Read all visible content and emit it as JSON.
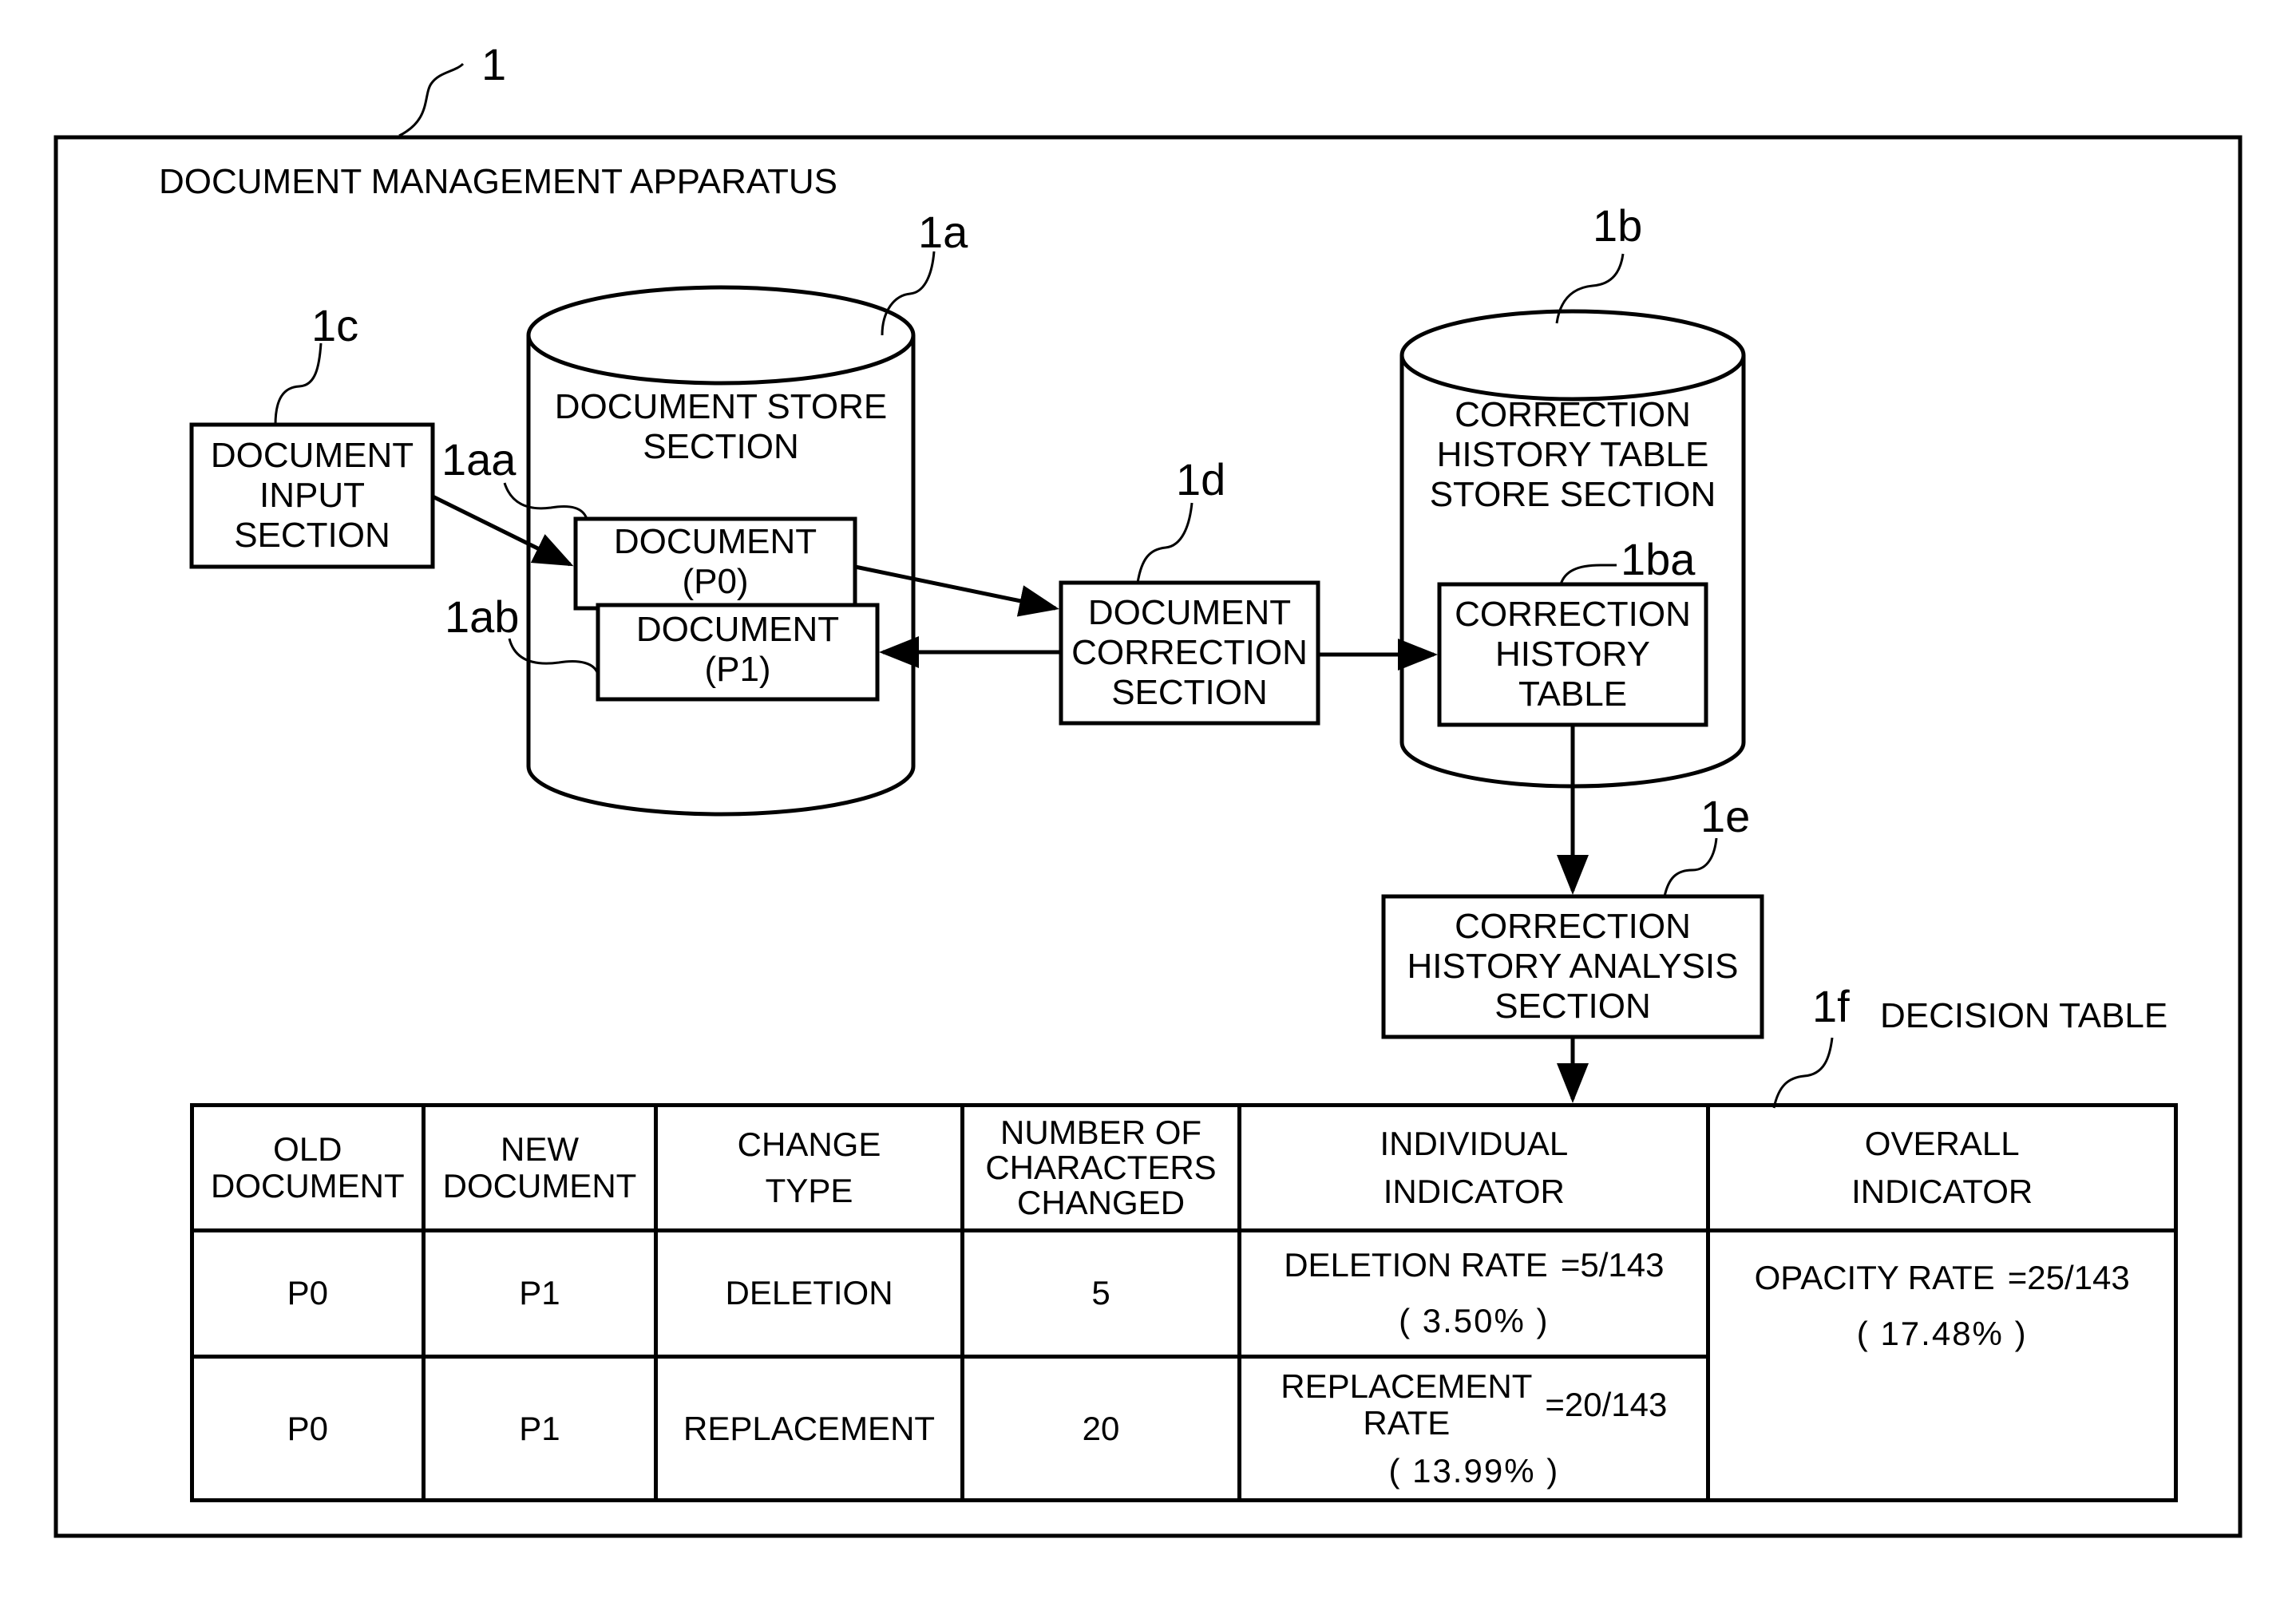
{
  "apparatus": {
    "ref": "1",
    "title": "DOCUMENT MANAGEMENT APPARATUS"
  },
  "components": {
    "document_store": {
      "ref": "1a",
      "lines": [
        "DOCUMENT STORE",
        "SECTION"
      ]
    },
    "correction_history_store": {
      "ref": "1b",
      "lines": [
        "CORRECTION",
        "HISTORY TABLE",
        "STORE SECTION"
      ]
    },
    "document_input": {
      "ref": "1c",
      "lines": [
        "DOCUMENT",
        "INPUT",
        "SECTION"
      ]
    },
    "document_p0": {
      "ref": "1aa",
      "lines": [
        "DOCUMENT",
        "(P0)"
      ]
    },
    "document_p1": {
      "ref": "1ab",
      "lines": [
        "DOCUMENT",
        "(P1)"
      ]
    },
    "document_correction": {
      "ref": "1d",
      "lines": [
        "DOCUMENT",
        "CORRECTION",
        "SECTION"
      ]
    },
    "correction_history_table": {
      "ref": "1ba",
      "lines": [
        "CORRECTION",
        "HISTORY",
        "TABLE"
      ]
    },
    "correction_history_analysis": {
      "ref": "1e",
      "lines": [
        "CORRECTION",
        "HISTORY ANALYSIS",
        "SECTION"
      ]
    }
  },
  "decision_table": {
    "ref": "1f",
    "label": "DECISION TABLE",
    "headers": [
      [
        "OLD",
        "DOCUMENT"
      ],
      [
        "NEW",
        "DOCUMENT"
      ],
      [
        "CHANGE",
        "TYPE"
      ],
      [
        "NUMBER OF",
        "CHARACTERS",
        "CHANGED"
      ],
      [
        "INDIVIDUAL",
        "INDICATOR"
      ],
      [
        "OVERALL",
        "INDICATOR"
      ]
    ],
    "rows": [
      {
        "old": "P0",
        "new": "P1",
        "change_type": "DELETION",
        "chars_changed": "5",
        "individual_name": [
          "DELETION RATE"
        ],
        "individual_fraction": "=5/143",
        "individual_percent": "(  3.50%  )"
      },
      {
        "old": "P0",
        "new": "P1",
        "change_type": "REPLACEMENT",
        "chars_changed": "20",
        "individual_name": [
          "REPLACEMENT",
          "RATE"
        ],
        "individual_fraction": "=20/143",
        "individual_percent": "(  13.99%  )"
      }
    ],
    "overall": {
      "name": "OPACITY RATE",
      "fraction": "=25/143",
      "percent": "(  17.48%  )"
    }
  }
}
